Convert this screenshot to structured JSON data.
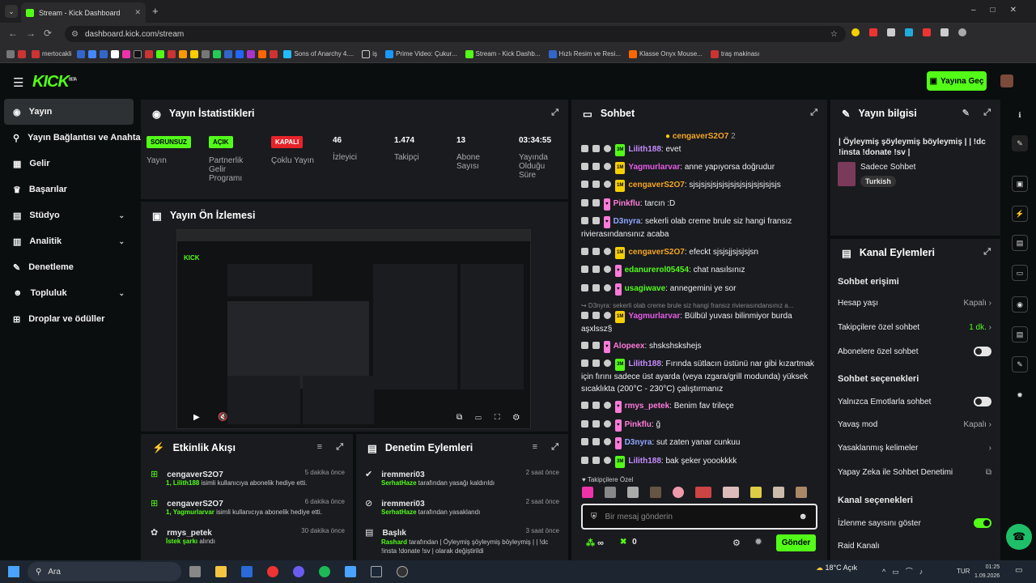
{
  "browser": {
    "tab_title": "Stream - Kick Dashboard",
    "url": "dashboard.kick.com/stream",
    "bookmarks": [
      "mertocakli",
      "Sons of Anarchy 4....",
      "iş",
      "Prime Video: Çukur...",
      "Stream - Kick Dashb...",
      "Hızlı Resim ve Resi...",
      "Klasse Onyx Mouse...",
      "traş makinası"
    ]
  },
  "header": {
    "logo": "KICK",
    "beta": "BETA",
    "go_live": "Yayına Geç"
  },
  "sidebar": {
    "items": [
      {
        "label": "Yayın"
      },
      {
        "label": "Yayın Bağlantısı ve Anahtarı"
      },
      {
        "label": "Gelir"
      },
      {
        "label": "Başarılar"
      },
      {
        "label": "Stüdyo"
      },
      {
        "label": "Analitik"
      },
      {
        "label": "Denetleme"
      },
      {
        "label": "Topluluk"
      },
      {
        "label": "Droplar ve ödüller"
      }
    ]
  },
  "stats": {
    "title": "Yayın İstatistikleri",
    "cols": [
      {
        "badge": "SORUNSUZ",
        "label": "Yayın"
      },
      {
        "badge": "AÇIK",
        "label": "Partnerlik Gelir Programı"
      },
      {
        "badge": "KAPALI",
        "label": "Çoklu Yayın"
      },
      {
        "value": "46",
        "label": "İzleyici"
      },
      {
        "value": "1.474",
        "label": "Takipçi"
      },
      {
        "value": "13",
        "label": "Abone Sayısı"
      },
      {
        "value": "03:34:55",
        "label": "Yayında Olduğu Süre"
      }
    ]
  },
  "preview": {
    "title": "Yayın Ön İzlemesi"
  },
  "activity": {
    "title": "Etkinlik Akışı",
    "items": [
      {
        "user": "cengaverS2O7",
        "time": "5 dakika önce",
        "who": "1, Lilith188",
        "text": " isimli kullanıcıya abonelik hediye etti."
      },
      {
        "user": "cengaverS2O7",
        "time": "6 dakika önce",
        "who": "1, Yagmurlarvar",
        "text": " isimli kullanıcıya abonelik hediye etti."
      },
      {
        "user": "rmys_petek",
        "time": "30 dakika önce",
        "who": "İstek şarkı",
        "text": " alındı"
      }
    ]
  },
  "moderation": {
    "title": "Denetim Eylemleri",
    "items": [
      {
        "user": "iremmeri03",
        "time": "2 saat önce",
        "who": "SerhatHaze",
        "text": " tarafından yasağı kaldırıldı"
      },
      {
        "user": "iremmeri03",
        "time": "2 saat önce",
        "who": "SerhatHaze",
        "text": " tarafından yasaklandı"
      },
      {
        "user": "Başlık",
        "time": "3 saat önce",
        "who": "Rashard",
        "text": " tarafından | Öyleymiş şöyleymiş böyleymiş | | !dc !insta !donate !sv | olarak değiştirildi"
      }
    ]
  },
  "chat": {
    "title": "Sohbet",
    "pinned_user": "cengaverS2O7",
    "pinned_count": "2",
    "messages": [
      {
        "user": "Lilith188",
        "color": "#c78cff",
        "text": ": evet"
      },
      {
        "user": "Yagmurlarvar",
        "color": "#e65ce6",
        "text": ": anne yapıyorsa doğrudur"
      },
      {
        "user": "cengaverS2O7",
        "color": "#f5a623",
        "text": ": sjsjsjsjsjsjsjsjsjsjsjsjsjsjsjs"
      },
      {
        "user": "Pinkflu",
        "color": "#ff7ad9",
        "text": ": tarcın :D"
      },
      {
        "user": "D3nyra",
        "color": "#8fa6ff",
        "text": ": sekerli olab creme brule siz hangi fransız rivierasındansınız acaba"
      },
      {
        "user": "cengaverS2O7",
        "color": "#f5a623",
        "text": ": efeckt sjsjsjjsjsjsjsn"
      },
      {
        "user": "edanurerol05454",
        "color": "#53fc18",
        "text": ": chat nasılsınız"
      },
      {
        "user": "usagiwave",
        "color": "#53fc18",
        "text": ": annegemini ye sor"
      },
      {
        "reply": "↪ D3nyra: sekerli olab creme brule siz hangi fransız rivierasındansınız a..."
      },
      {
        "user": "Yagmurlarvar",
        "color": "#e65ce6",
        "text": ": Bülbül yuvası bilinmiyor burda aşxlssz§"
      },
      {
        "user": "Alopeex",
        "color": "#ff7ad9",
        "text": ": shskshskshejs"
      },
      {
        "user": "Lilith188",
        "color": "#c78cff",
        "text": ": Fırında sütlacın üstünü nar gibi kızartmak için fırını sadece üst ayarda (veya ızgara/grill modunda) yüksek sıcaklıkta (200°C - 230°C) çalıştırmanız"
      },
      {
        "user": "rmys_petek",
        "color": "#ff7ad9",
        "text": ": Benim fav trileçe"
      },
      {
        "user": "Pinkflu",
        "color": "#ff7ad9",
        "text": ": ğ"
      },
      {
        "user": "D3nyra",
        "color": "#8fa6ff",
        "text": ": sut zaten yanar cunkuu"
      },
      {
        "user": "Lilith188",
        "color": "#c78cff",
        "text": ": bak şeker yoookkkk"
      }
    ],
    "followers_only": "Takipçilere Özel",
    "placeholder": "Bir mesaj gönderin",
    "points": "∞",
    "count": "0",
    "send": "Gönder"
  },
  "info": {
    "title": "Yayın bilgisi",
    "stream_title": "| Öyleymiş şöyleymiş böyleymiş | | !dc !insta !donate !sv |",
    "category": "Sadece Sohbet",
    "tag": "Turkish"
  },
  "channel": {
    "title": "Kanal Eylemleri",
    "sec1": "Sohbet erişimi",
    "account_age": "Hesap yaşı",
    "account_age_val": "Kapalı",
    "followers": "Takipçilere özel sohbet",
    "followers_val": "1 dk.",
    "subs": "Abonelere özel sohbet",
    "sec2": "Sohbet seçenekleri",
    "emotes": "Yalnızca Emotlarla sohbet",
    "slow": "Yavaş mod",
    "slow_val": "Kapalı",
    "banned": "Yasaklanmış kelimeler",
    "ai": "Yapay Zeka ile Sohbet Denetimi",
    "sec3": "Kanal seçenekleri",
    "viewcount": "İzlenme sayısını göster",
    "raid": "Raid Kanalı"
  },
  "taskbar": {
    "search": "Ara",
    "weather": "18°C",
    "weather_desc": "Açık",
    "lang": "TUR",
    "time": "01:25",
    "date": "1.09.2026"
  }
}
